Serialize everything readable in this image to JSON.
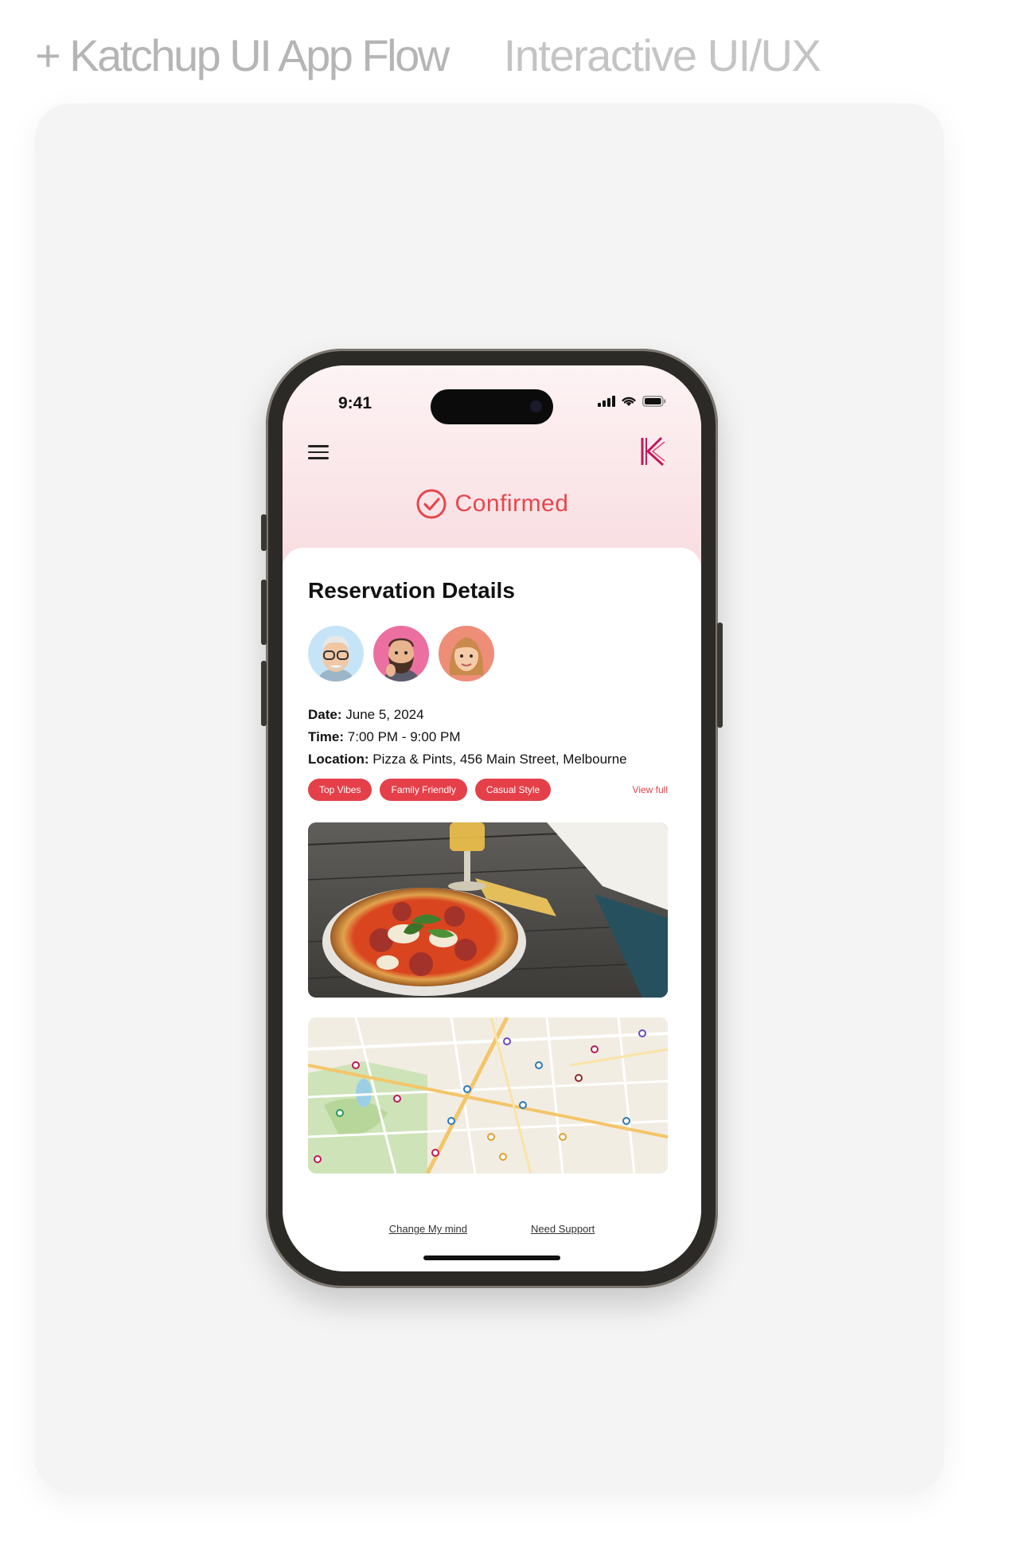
{
  "page": {
    "heading": "+ Katchup UI App Flow",
    "subheading": "Interactive UI/UX"
  },
  "colors": {
    "accent": "#e5404a",
    "confirmed": "#e5474b",
    "logo": "#c0185b",
    "card_bg": "#f4f4f4"
  },
  "status_bar": {
    "time": "9:41",
    "icons": [
      "signal-icon",
      "wifi-icon",
      "battery-icon"
    ]
  },
  "header": {
    "menu_icon": "hamburger-menu-icon",
    "logo_icon": "katchup-k-logo",
    "status_icon": "check-circle-icon",
    "status": "Confirmed"
  },
  "reservation": {
    "title": "Reservation Details",
    "guests": [
      "avatar-man-glasses",
      "avatar-man-beard",
      "avatar-woman"
    ],
    "date_label": "Date:",
    "date_value": "June 5, 2024",
    "time_label": "Time:",
    "time_value": "7:00 PM - 9:00 PM",
    "location_label": "Location:",
    "location_value": "Pizza & Pints, 456 Main Street, Melbourne",
    "tags": [
      "Top Vibes",
      "Family Friendly",
      "Casual Style"
    ],
    "view_full": "View full"
  },
  "footer": {
    "change_mind": "Change My mind",
    "need_support": "Need Support"
  }
}
